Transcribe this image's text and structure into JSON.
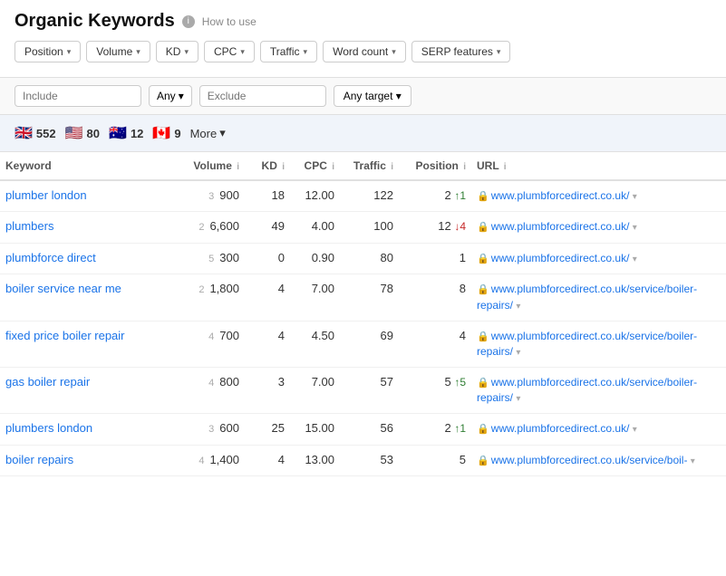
{
  "page": {
    "title": "Organic Keywords",
    "how_to_use": "How to use",
    "info_char": "i"
  },
  "filters": [
    {
      "label": "Position",
      "id": "position"
    },
    {
      "label": "Volume",
      "id": "volume"
    },
    {
      "label": "KD",
      "id": "kd"
    },
    {
      "label": "CPC",
      "id": "cpc"
    },
    {
      "label": "Traffic",
      "id": "traffic"
    },
    {
      "label": "Word count",
      "id": "word-count"
    },
    {
      "label": "SERP features",
      "id": "serp-features"
    }
  ],
  "filter_row": {
    "include_placeholder": "Include",
    "any_label": "Any",
    "exclude_placeholder": "Exclude",
    "any_target_label": "Any target"
  },
  "flags": [
    {
      "flag": "🇬🇧",
      "count": "552",
      "id": "uk"
    },
    {
      "flag": "🇺🇸",
      "count": "80",
      "id": "us"
    },
    {
      "flag": "🇦🇺",
      "count": "12",
      "id": "au"
    },
    {
      "flag": "🇨🇦",
      "count": "9",
      "id": "ca"
    }
  ],
  "more_label": "More",
  "table": {
    "headers": [
      {
        "label": "Keyword",
        "id": "keyword",
        "info": false
      },
      {
        "label": "Volume",
        "id": "volume",
        "info": true
      },
      {
        "label": "KD",
        "id": "kd",
        "info": true
      },
      {
        "label": "CPC",
        "id": "cpc",
        "info": true
      },
      {
        "label": "Traffic",
        "id": "traffic",
        "info": true
      },
      {
        "label": "Position",
        "id": "position",
        "info": true
      },
      {
        "label": "URL",
        "id": "url",
        "info": true
      }
    ],
    "rows": [
      {
        "keyword": "plumber london",
        "word_count": 3,
        "volume": "900",
        "kd": "18",
        "cpc": "12.00",
        "traffic": "122",
        "position": "2",
        "pos_change_dir": "up",
        "pos_change_val": "1",
        "url": "www.plumbforcedirect.co.uk/"
      },
      {
        "keyword": "plumbers",
        "word_count": 2,
        "volume": "6,600",
        "kd": "49",
        "cpc": "4.00",
        "traffic": "100",
        "position": "12",
        "pos_change_dir": "down",
        "pos_change_val": "4",
        "url": "www.plumbforcedirect.co.uk/"
      },
      {
        "keyword": "plumbforce direct",
        "word_count": 5,
        "volume": "300",
        "kd": "0",
        "cpc": "0.90",
        "traffic": "80",
        "position": "1",
        "pos_change_dir": "none",
        "pos_change_val": "",
        "url": "www.plumbforcedirect.co.uk/"
      },
      {
        "keyword": "boiler service near me",
        "word_count": 2,
        "volume": "1,800",
        "kd": "4",
        "cpc": "7.00",
        "traffic": "78",
        "position": "8",
        "pos_change_dir": "none",
        "pos_change_val": "",
        "url": "www.plumbforcedirect.co.uk/service/boiler-repairs/"
      },
      {
        "keyword": "fixed price boiler repair",
        "word_count": 4,
        "volume": "700",
        "kd": "4",
        "cpc": "4.50",
        "traffic": "69",
        "position": "4",
        "pos_change_dir": "none",
        "pos_change_val": "",
        "url": "www.plumbforcedirect.co.uk/service/boiler-repairs/"
      },
      {
        "keyword": "gas boiler repair",
        "word_count": 4,
        "volume": "800",
        "kd": "3",
        "cpc": "7.00",
        "traffic": "57",
        "position": "5",
        "pos_change_dir": "up",
        "pos_change_val": "5",
        "url": "www.plumbforcedirect.co.uk/service/boiler-repairs/"
      },
      {
        "keyword": "plumbers london",
        "word_count": 3,
        "volume": "600",
        "kd": "25",
        "cpc": "15.00",
        "traffic": "56",
        "position": "2",
        "pos_change_dir": "up",
        "pos_change_val": "1",
        "url": "www.plumbforcedirect.co.uk/"
      },
      {
        "keyword": "boiler repairs",
        "word_count": 4,
        "volume": "1,400",
        "kd": "4",
        "cpc": "13.00",
        "traffic": "53",
        "position": "5",
        "pos_change_dir": "none",
        "pos_change_val": "",
        "url": "www.plumbforcedirect.co.uk/service/boil-"
      }
    ]
  }
}
